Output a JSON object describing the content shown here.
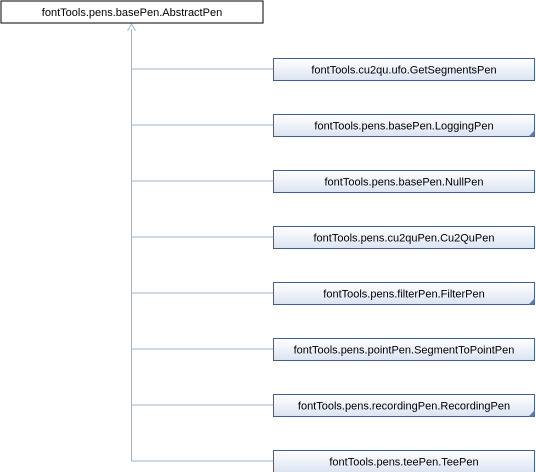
{
  "base_class": {
    "label": "fontTools.pens.basePen.AbstractPen"
  },
  "derived_classes": [
    {
      "label": "fontTools.cu2qu.ufo.GetSegmentsPen",
      "has_subclasses": false
    },
    {
      "label": "fontTools.pens.basePen.LoggingPen",
      "has_subclasses": true
    },
    {
      "label": "fontTools.pens.basePen.NullPen",
      "has_subclasses": false
    },
    {
      "label": "fontTools.pens.cu2quPen.Cu2QuPen",
      "has_subclasses": false
    },
    {
      "label": "fontTools.pens.filterPen.FilterPen",
      "has_subclasses": true
    },
    {
      "label": "fontTools.pens.pointPen.SegmentToPointPen",
      "has_subclasses": false
    },
    {
      "label": "fontTools.pens.recordingPen.RecordingPen",
      "has_subclasses": true
    },
    {
      "label": "fontTools.pens.teePen.TeePen",
      "has_subclasses": false
    }
  ],
  "colors": {
    "base_fill": "#ffffff",
    "base_border": "#000000",
    "node_fill_top": "#ffffff",
    "node_fill_bottom": "#dbe3f2",
    "node_border": "#3f5f8f",
    "edge": "#9eb4d6",
    "corner_marker": "#5b7ab0"
  }
}
